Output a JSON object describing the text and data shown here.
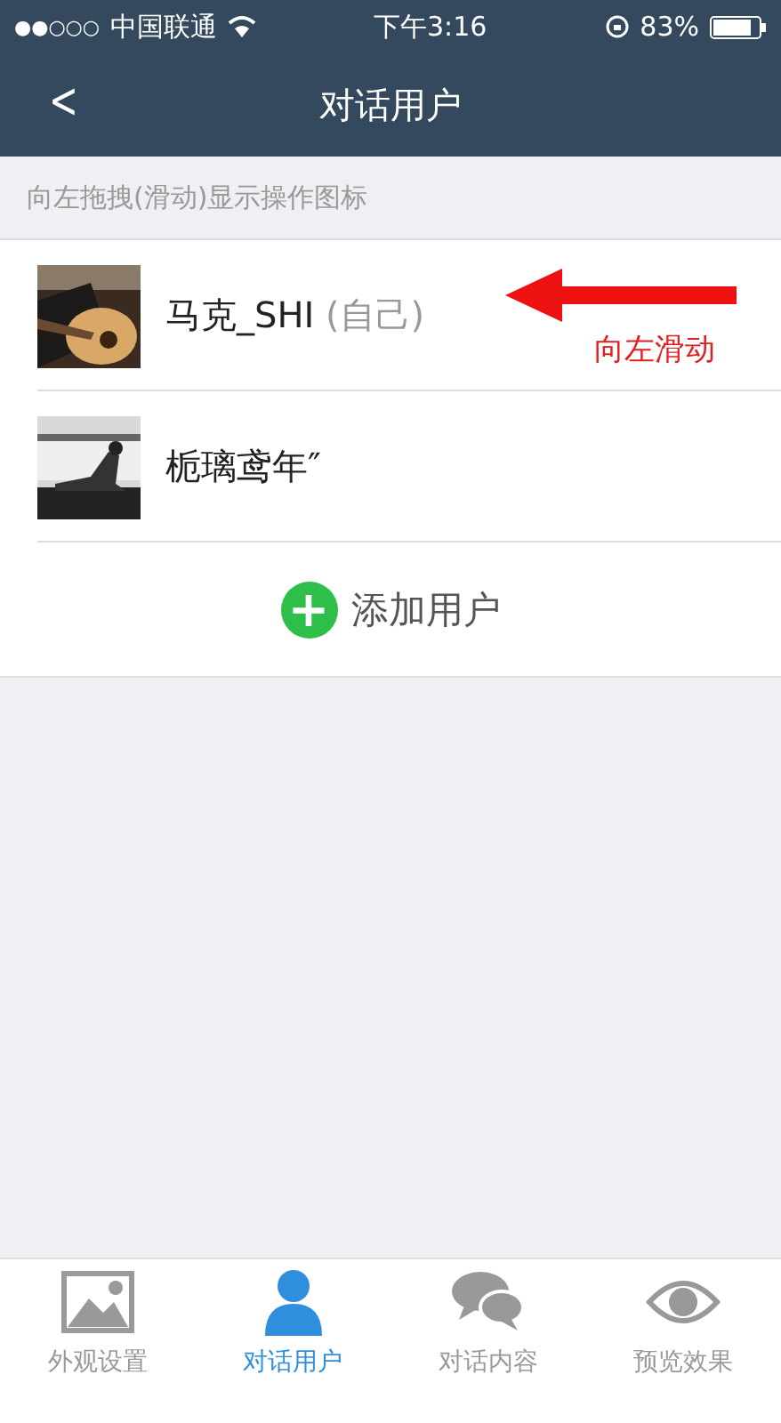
{
  "status_bar": {
    "signal_dots": "●●○○○",
    "carrier": "中国联通",
    "time": "下午3:16",
    "battery": "83%"
  },
  "nav_bar": {
    "back": "<",
    "title": "对话用户"
  },
  "hint": "向左拖拽(滑动)显示操作图标",
  "users": [
    {
      "name": "马克_SHI",
      "tag": "(自己)"
    },
    {
      "name": "栀璃鸢年″"
    }
  ],
  "add_user": {
    "icon": "+",
    "label": "添加用户"
  },
  "annotation": {
    "text": "向左滑动"
  },
  "tab_bar": [
    {
      "label": "外观设置",
      "selected": false
    },
    {
      "label": "对话用户",
      "selected": true
    },
    {
      "label": "对话内容",
      "selected": false
    },
    {
      "label": "预览效果",
      "selected": false
    }
  ]
}
